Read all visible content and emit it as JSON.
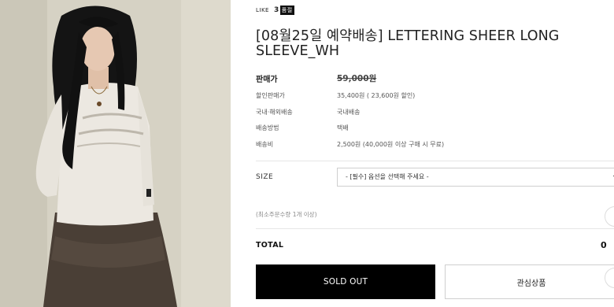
{
  "like": {
    "label": "LIKE",
    "count": "3",
    "badge": "품절"
  },
  "product": {
    "title": "[08월25일 예약배송] LETTERING SHEER LONG SLEEVE_WH"
  },
  "details": [
    {
      "label": "판매가",
      "value": "59,000원"
    },
    {
      "label": "할인판매가",
      "value": "35,400원 ( 23,600원 할인)"
    },
    {
      "label": "국내·해외배송",
      "value": "국내배송"
    },
    {
      "label": "배송방법",
      "value": "택배"
    },
    {
      "label": "배송비",
      "value": "2,500원 (40,000원 이상 구매 시 무료)"
    }
  ],
  "size": {
    "label": "SIZE",
    "selected": "- [필수] 옵션을 선택해 주세요 -"
  },
  "min_qty_note": "(최소주문수량 1개 이상)",
  "total": {
    "label": "TOTAL",
    "value": "0"
  },
  "buttons": {
    "sold_out": "SOLD OUT",
    "wishlist": "관심상품"
  },
  "colors": {
    "primary_button": "#000000",
    "divider": "#e6e6e6"
  }
}
